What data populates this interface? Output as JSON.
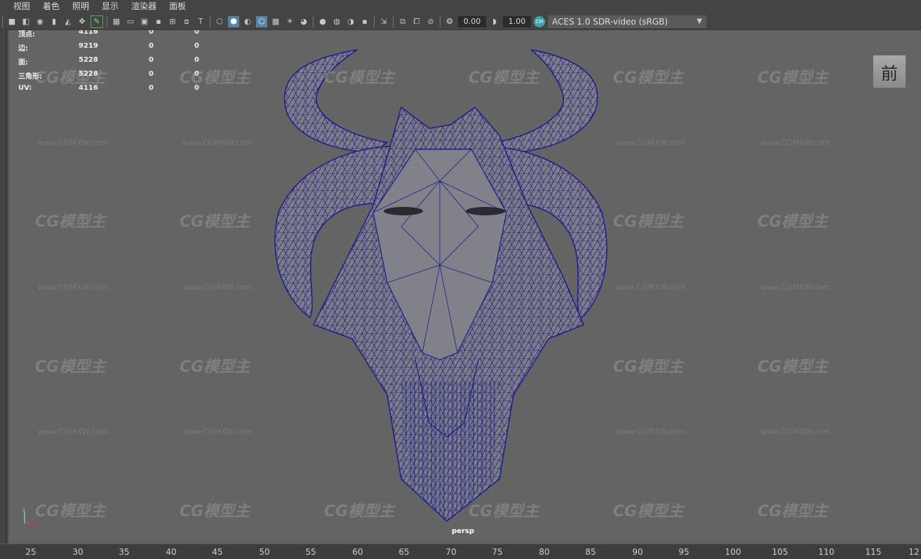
{
  "menu": [
    "视图",
    "着色",
    "照明",
    "显示",
    "渲染器",
    "面板"
  ],
  "toolbar": {
    "exposure_value": "0.00",
    "gamma_value": "1.00",
    "color_management_badge": "CM",
    "color_space": "ACES 1.0 SDR-video (sRGB)",
    "icons": [
      "camera-icon",
      "camera-attributes-icon",
      "bookmark-icon",
      "image-plane-icon",
      "grid-icon",
      "film-gate-icon",
      "resolution-gate-icon",
      "safe-area-icon",
      "wireframe-icon",
      "smooth-shade-icon",
      "textured-icon",
      "lights-icon",
      "shadows-icon",
      "isolate-icon",
      "xray-icon",
      "ambient-occlusion-icon",
      "motion-blur-icon",
      "anti-alias-icon",
      "select-camera-icon",
      "exposure-icon",
      "gamma-icon",
      "color-management-icon"
    ]
  },
  "hud": {
    "rows": [
      {
        "label": "顶点:",
        "total": "4116",
        "selected": "0",
        "other": "0"
      },
      {
        "label": "边:",
        "total": "9219",
        "selected": "0",
        "other": "0"
      },
      {
        "label": "面:",
        "total": "5228",
        "selected": "0",
        "other": "0"
      },
      {
        "label": "三角形:",
        "total": "5228",
        "selected": "0",
        "other": "0"
      },
      {
        "label": "UV:",
        "total": "4116",
        "selected": "0",
        "other": "0"
      }
    ]
  },
  "viewport": {
    "view_cube_label": "前",
    "camera_label": "persp",
    "axis": {
      "x": "x",
      "y": "y"
    },
    "watermark_logo": "CG模型主",
    "watermark_url": "www.CGMXW.com"
  },
  "ruler": [
    "25",
    "30",
    "35",
    "40",
    "45",
    "50",
    "55",
    "60",
    "65",
    "70",
    "75",
    "80",
    "85",
    "90",
    "95",
    "100",
    "105",
    "110",
    "115",
    "12"
  ],
  "colors": {
    "viewport_bg": "#646464",
    "wireframe": "#1c1c8c",
    "mesh_fill": "#7e7e86"
  }
}
